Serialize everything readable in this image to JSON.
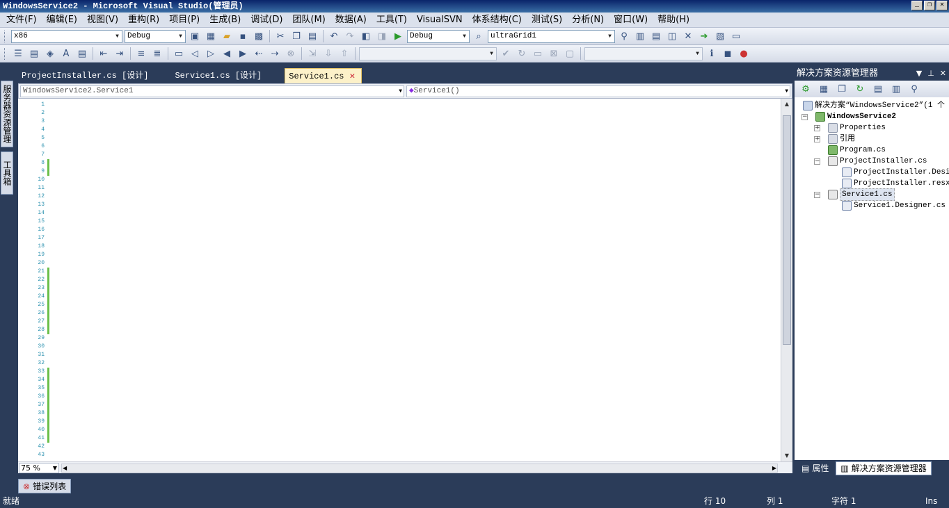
{
  "window": {
    "title": "WindowsService2 - Microsoft Visual Studio(管理员)"
  },
  "window_buttons": [
    "_",
    "❐",
    "✕"
  ],
  "menu": [
    "文件(F)",
    "编辑(E)",
    "视图(V)",
    "重构(R)",
    "项目(P)",
    "生成(B)",
    "调试(D)",
    "团队(M)",
    "数据(A)",
    "工具(T)",
    "VisualSVN",
    "体系结构(C)",
    "测试(S)",
    "分析(N)",
    "窗口(W)",
    "帮助(H)"
  ],
  "toolbar1": {
    "platform": "x86",
    "config": "Debug",
    "debug_config": "Debug",
    "find_combo": "ultraGrid1"
  },
  "left_tabs": {
    "server_explorer": "服务器资源管理器",
    "toolbox": "工具箱"
  },
  "doc_tabs": [
    {
      "label": "ProjectInstaller.cs [设计]"
    },
    {
      "label": "Service1.cs [设计]"
    },
    {
      "label": "Service1.cs"
    }
  ],
  "nav": {
    "type": "WindowsService2.Service1",
    "member": "Service1()"
  },
  "code": {
    "line_numbers": [
      "1",
      "2",
      "3",
      "4",
      "5",
      "6",
      "7",
      "8",
      "9",
      "10",
      "11",
      "12",
      "13",
      "14",
      "15",
      "16",
      "17",
      "18",
      "19",
      "20",
      "21",
      "22",
      "23",
      "24",
      "25",
      "26",
      "27",
      "28",
      "29",
      "30",
      "31",
      "32",
      "33",
      "34",
      "35",
      "36",
      "37",
      "38",
      "39",
      "40",
      "41",
      "42",
      "43"
    ]
  },
  "zoom": "75 %",
  "bottom_tab": {
    "label": "错误列表"
  },
  "status": {
    "ready": "就绪",
    "row": "行 10",
    "col": "列 1",
    "char": "字符 1",
    "mode": "Ins"
  },
  "solution_explorer": {
    "title": "解决方案资源管理器",
    "tree": {
      "solution": "解决方案“WindowsService2”(1 个",
      "project": "WindowsService2",
      "properties": "Properties",
      "references": "引用",
      "program": "Program.cs",
      "installer": "ProjectInstaller.cs",
      "installer_designer": "ProjectInstaller.Desi",
      "installer_resx": "ProjectInstaller.resx",
      "service": "Service1.cs",
      "service_designer": "Service1.Designer.cs"
    },
    "bottom_tabs": {
      "properties": "属性",
      "solution": "解决方案资源管理器"
    }
  }
}
